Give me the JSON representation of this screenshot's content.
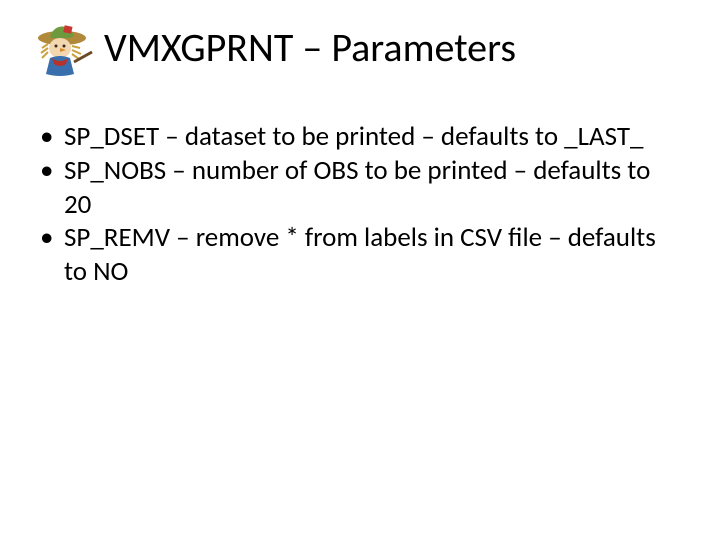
{
  "title": "VMXGPRNT – Parameters",
  "bullets": [
    "SP_DSET – dataset to be printed – defaults to _LAST_",
    "SP_NOBS – number of OBS to be printed – defaults to 20",
    "SP_REMV – remove * from labels in CSV file – defaults to NO"
  ]
}
